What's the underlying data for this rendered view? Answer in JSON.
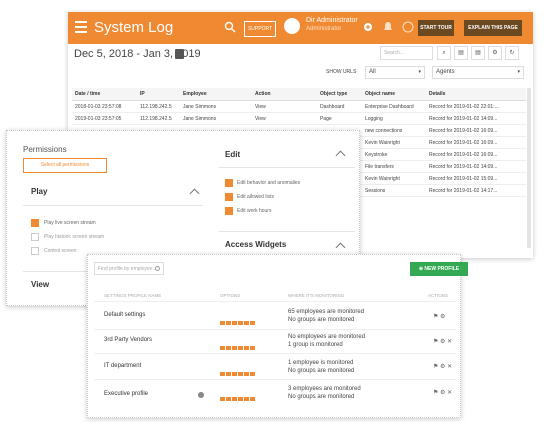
{
  "log": {
    "title": "System Log",
    "support_label": "SUPPORT",
    "user_name": "Dir Administrator",
    "user_sub": "Administrator",
    "start_tour_label": "START TOUR",
    "explain_label": "EXPLAIN THIS PAGE",
    "date_range": "Dec 5, 2018 - Jan 3, 2019",
    "search_placeholder": "Search...",
    "show_urls_label": "SHOW URLS",
    "filter_all": "All",
    "filter_agents": "Agents",
    "columns": [
      "Date / time",
      "IP",
      "Employee",
      "Action",
      "Object type",
      "Object name",
      "Details"
    ],
    "rows": [
      [
        "2018-01-03 23:57:08",
        "112.198.242.5",
        "Jane Simmons",
        "View",
        "Dashboard",
        "Enterprise Dashboard",
        "Record for 2019-01-02 22:01:..."
      ],
      [
        "2019-01-03 23:57:05",
        "112.198.242.5",
        "Jane Simmons",
        "View",
        "Page",
        "Logging",
        "Record for 2019-01-02 14:09..."
      ],
      [
        "",
        "",
        "",
        "",
        "",
        "new connections",
        "Record for 2019-01-02 16:09..."
      ],
      [
        "",
        "",
        "",
        "",
        "",
        "Kevin Wainright",
        "Record for 2019-01-02 16:09..."
      ],
      [
        "",
        "",
        "",
        "",
        "",
        "Keystroke",
        "Record for 2019-01-02 16:09..."
      ],
      [
        "",
        "",
        "",
        "",
        "",
        "File transfers",
        "Record for 2019-01-02 14:09..."
      ],
      [
        "",
        "",
        "",
        "",
        "",
        "Kevin Wainright",
        "Record for 2019-01-02 15:09..."
      ],
      [
        "",
        "",
        "",
        "",
        "",
        "Sessions",
        "Record for 2019-01-02 14:17..."
      ]
    ]
  },
  "permissions": {
    "title": "Permissions",
    "select_all_label": "Select all permissions",
    "play_header": "Play",
    "play_items": [
      "Play live screen stream",
      "Play historic screen stream",
      "Control screen"
    ],
    "view_header": "View",
    "edit_header": "Edit",
    "edit_items": [
      "Edit behavior and anomalies",
      "Edit allowed lists",
      "Edit work hours"
    ],
    "access_widgets_header": "Access Widgets"
  },
  "profiles": {
    "find_placeholder": "Find profile by employee...",
    "new_profile_label": "NEW PROFILE",
    "headers": {
      "name": "Settings Profile Name",
      "options": "Options",
      "monitoring": "Where it's monitoring",
      "actions": "Actions"
    },
    "rows": [
      {
        "name": "Default settings",
        "monitored": "65 employees are monitored",
        "groups": "No groups are monitored"
      },
      {
        "name": "3rd Party Vendors",
        "monitored": "No employees are monitored",
        "groups": "1 group is monitored"
      },
      {
        "name": "IT department",
        "monitored": "1 employee is monitored",
        "groups": "No groups are monitored"
      },
      {
        "name": "Executive profile",
        "monitored": "3 employees are monitored",
        "groups": "No groups are monitored"
      }
    ]
  },
  "colors": {
    "accent": "#f08a32",
    "green": "#34a853",
    "dark_brown": "#6b4a22"
  }
}
